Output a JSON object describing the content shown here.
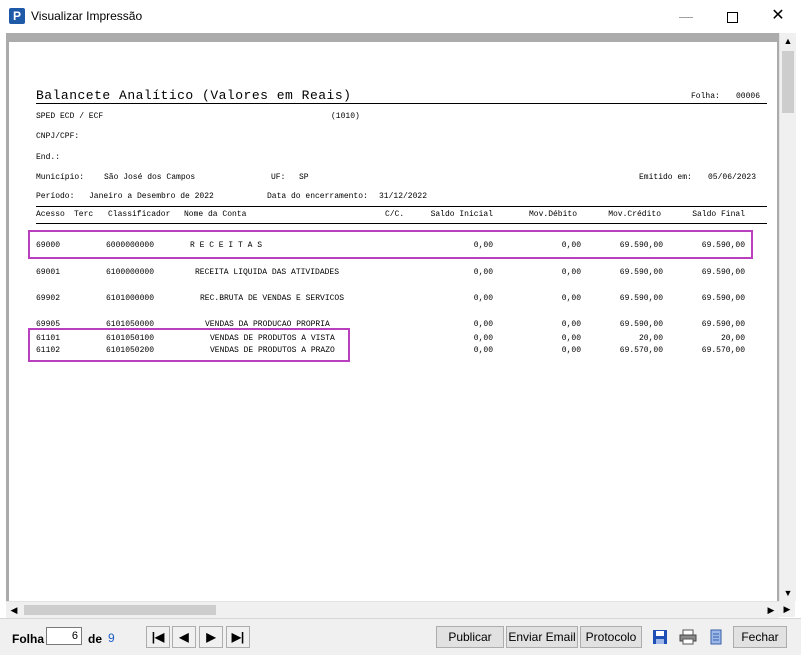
{
  "window": {
    "title": "Visualizar Impressão",
    "app_icon": "P"
  },
  "report": {
    "title": "Balancete Analítico (Valores em Reais)",
    "folha_label": "Folha:",
    "folha_value": "00006",
    "sped": "SPED ECD / ECF",
    "code": "(1010)",
    "cnpj_label": "CNPJ/CPF:",
    "end_label": "End.:",
    "municipio_label": "Município:",
    "municipio_value": "São José dos Campos",
    "uf_label": "UF:",
    "uf_value": "SP",
    "emitido_label": "Emitido em:",
    "emitido_value": "05/06/2023",
    "periodo_label": "Período:",
    "periodo_value": "Janeiro a Desembro de 2022",
    "encerramento_label": "Data do encerramento:",
    "encerramento_value": "31/12/2022",
    "columns": [
      "Acesso",
      "Terc",
      "Classificador",
      "Nome da Conta",
      "C/C.",
      "Saldo Inicial",
      "Mov.Débito",
      "Mov.Crédito",
      "Saldo Final"
    ],
    "rows": [
      {
        "acesso": "69000",
        "class": "6000000000",
        "nome": "R E C E I T A S",
        "saldo_inicial": "0,00",
        "debito": "0,00",
        "credito": "69.590,00",
        "saldo_final": "69.590,00"
      },
      {
        "acesso": "69001",
        "class": "6100000000",
        "nome": "RECEITA LIQUIDA DAS ATIVIDADES",
        "saldo_inicial": "0,00",
        "debito": "0,00",
        "credito": "69.590,00",
        "saldo_final": "69.590,00"
      },
      {
        "acesso": "69902",
        "class": "6101000000",
        "nome": "REC.BRUTA DE VENDAS E SERVICOS",
        "saldo_inicial": "0,00",
        "debito": "0,00",
        "credito": "69.590,00",
        "saldo_final": "69.590,00"
      },
      {
        "acesso": "69905",
        "class": "6101050000",
        "nome": "VENDAS DA PRODUCAO PROPRIA",
        "saldo_inicial": "0,00",
        "debito": "0,00",
        "credito": "69.590,00",
        "saldo_final": "69.590,00"
      },
      {
        "acesso": "61101",
        "class": "6101050100",
        "nome": "VENDAS DE PRODUTOS A VISTA",
        "saldo_inicial": "0,00",
        "debito": "0,00",
        "credito": "20,00",
        "saldo_final": "20,00"
      },
      {
        "acesso": "61102",
        "class": "6101050200",
        "nome": "VENDAS DE PRODUTOS A PRAZO",
        "saldo_inicial": "0,00",
        "debito": "0,00",
        "credito": "69.570,00",
        "saldo_final": "69.570,00"
      }
    ]
  },
  "toolbar": {
    "folha_label": "Folha",
    "current_page": "6",
    "de_label": "de",
    "total_pages": "9",
    "first": "|◀",
    "prev": "◀",
    "next": "▶",
    "last": "▶|",
    "publicar": "Publicar",
    "enviar_email": "Enviar Email",
    "protocolo": "Protocolo",
    "fechar": "Fechar"
  },
  "highlight_color": "#b93fbf"
}
